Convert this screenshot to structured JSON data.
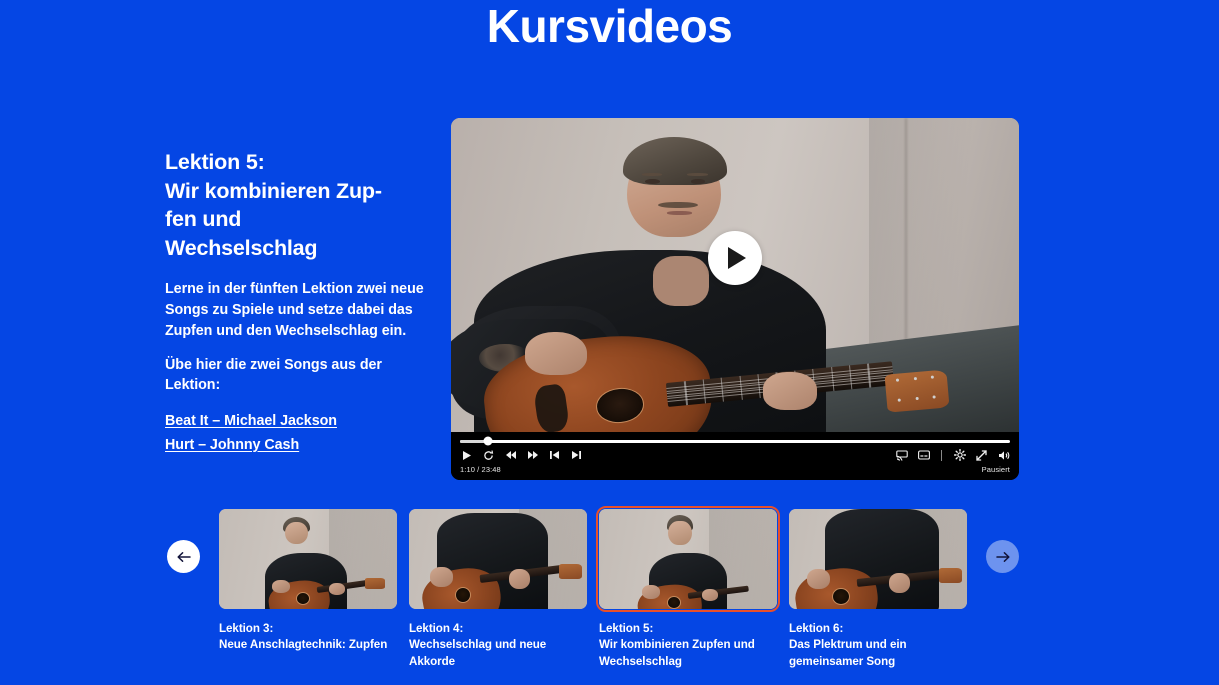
{
  "page": {
    "title": "Kursvideos",
    "background_color": "#0546e4",
    "accent_color": "#e8502a"
  },
  "lesson": {
    "heading": "Lektion 5:\nWir kombinieren Zup-\nfen und\nWechselschlag",
    "paragraph_1": "Lerne in der fünften Lektion zwei neue Songs zu Spiele und setze dabei das Zupfen und den Wechselschlag ein.",
    "paragraph_2": "Übe hier die zwei Songs aus der Lektion:",
    "links": [
      {
        "label": "Beat It – Michael Jackson"
      },
      {
        "label": "Hurt – Johnny Cash"
      }
    ]
  },
  "player": {
    "play_button_icon": "play-icon",
    "current_time": "1:10",
    "duration": "23:48",
    "time_display": "1:10 / 23:48",
    "status": "Pausiert",
    "progress_percent": 5,
    "left_controls": [
      {
        "icon": "play-icon"
      },
      {
        "icon": "replay-icon"
      },
      {
        "icon": "rewind-icon"
      },
      {
        "icon": "fast-forward-icon"
      },
      {
        "icon": "previous-track-icon"
      },
      {
        "icon": "next-track-icon"
      }
    ],
    "right_controls": [
      {
        "icon": "cast-icon"
      },
      {
        "icon": "subtitles-icon"
      },
      {
        "icon": "divider"
      },
      {
        "icon": "settings-gear-icon"
      },
      {
        "icon": "fullscreen-icon"
      },
      {
        "icon": "volume-icon"
      }
    ]
  },
  "carousel": {
    "prev_label": "arrow-left-icon",
    "next_label": "arrow-right-icon",
    "cards": [
      {
        "lesson_no": "Lektion 3:",
        "title": "Neue Anschlagtechnik: Zupfen",
        "active": false
      },
      {
        "lesson_no": "Lektion 4:",
        "title": "Wechselschlag und neue Akkorde",
        "active": false
      },
      {
        "lesson_no": "Lektion 5:",
        "title": "Wir kombinieren Zupfen und Wechselschlag",
        "active": true
      },
      {
        "lesson_no": "Lektion 6:",
        "title": "Das Plektrum und ein gemeinsamer Song",
        "active": false
      }
    ]
  }
}
